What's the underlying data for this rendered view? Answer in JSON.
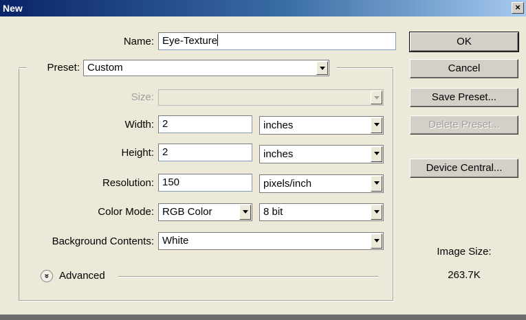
{
  "window": {
    "title": "New",
    "close_glyph": "×"
  },
  "form": {
    "name": {
      "label": "Name:",
      "value": "Eye-Texture"
    },
    "preset": {
      "label": "Preset:",
      "value": "Custom"
    },
    "size": {
      "label": "Size:",
      "value": ""
    },
    "width": {
      "label": "Width:",
      "value": "2",
      "unit": "inches"
    },
    "height": {
      "label": "Height:",
      "value": "2",
      "unit": "inches"
    },
    "resolution": {
      "label": "Resolution:",
      "value": "150",
      "unit": "pixels/inch"
    },
    "color_mode": {
      "label": "Color Mode:",
      "value": "RGB Color",
      "bit_depth": "8 bit"
    },
    "background": {
      "label": "Background Contents:",
      "value": "White"
    },
    "advanced": {
      "label": "Advanced",
      "icon": "»"
    }
  },
  "buttons": {
    "ok": "OK",
    "cancel": "Cancel",
    "save_preset": "Save Preset...",
    "delete_preset": "Delete Preset...",
    "device_central": "Device Central..."
  },
  "info": {
    "image_size_label": "Image Size:",
    "image_size_value": "263.7K"
  }
}
